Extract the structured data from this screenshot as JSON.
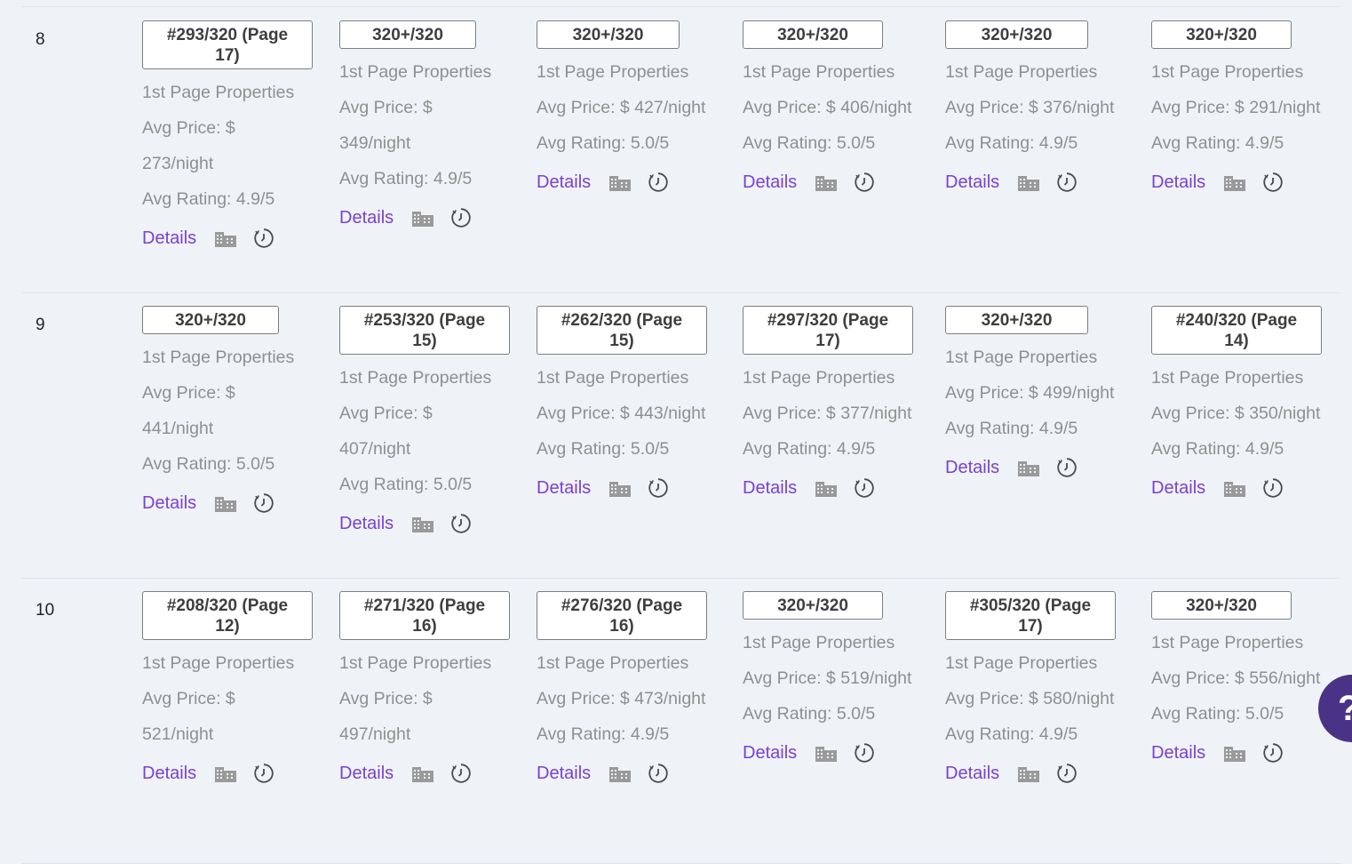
{
  "labels": {
    "properties": "1st Page Properties",
    "details": "Details",
    "avg_price_prefix": "Avg Price: $",
    "avg_rating_prefix": "Avg Rating: "
  },
  "icons": {
    "building": "building-icon",
    "history": "history-icon"
  },
  "colors": {
    "link": "#7a40cf",
    "muted_text": "#8f8f8f",
    "icon": "#9a9a9a",
    "help_button": "#4a3386"
  },
  "help_button": {
    "label": "?"
  },
  "rows": [
    {
      "num": "8",
      "cells": [
        {
          "rank_line1": "#293/320 (Page",
          "rank_line2": "17)",
          "price_line1": "Avg Price: $",
          "price_line2": "273/night",
          "rating": "Avg Rating: 4.9/5"
        },
        {
          "rank_line1": "320+/320",
          "rank_line2": "",
          "price_line1": "Avg Price: $",
          "price_line2": "349/night",
          "rating": "Avg Rating: 4.9/5"
        },
        {
          "rank_line1": "320+/320",
          "rank_line2": "",
          "price_line1": "Avg Price: $ 427/night",
          "price_line2": "",
          "rating": "Avg Rating: 5.0/5"
        },
        {
          "rank_line1": "320+/320",
          "rank_line2": "",
          "price_line1": "Avg Price: $ 406/night",
          "price_line2": "",
          "rating": "Avg Rating: 5.0/5"
        },
        {
          "rank_line1": "320+/320",
          "rank_line2": "",
          "price_line1": "Avg Price: $ 376/night",
          "price_line2": "",
          "rating": "Avg Rating: 4.9/5"
        },
        {
          "rank_line1": "320+/320",
          "rank_line2": "",
          "price_line1": "Avg Price: $ 291/night",
          "price_line2": "",
          "rating": "Avg Rating: 4.9/5"
        }
      ]
    },
    {
      "num": "9",
      "cells": [
        {
          "rank_line1": "320+/320",
          "rank_line2": "",
          "price_line1": "Avg Price: $",
          "price_line2": "441/night",
          "rating": "Avg Rating: 5.0/5"
        },
        {
          "rank_line1": "#253/320 (Page",
          "rank_line2": "15)",
          "price_line1": "Avg Price: $",
          "price_line2": "407/night",
          "rating": "Avg Rating: 5.0/5"
        },
        {
          "rank_line1": "#262/320 (Page",
          "rank_line2": "15)",
          "price_line1": "Avg Price: $ 443/night",
          "price_line2": "",
          "rating": "Avg Rating: 5.0/5"
        },
        {
          "rank_line1": "#297/320 (Page",
          "rank_line2": "17)",
          "price_line1": "Avg Price: $ 377/night",
          "price_line2": "",
          "rating": "Avg Rating: 4.9/5"
        },
        {
          "rank_line1": "320+/320",
          "rank_line2": "",
          "price_line1": "Avg Price: $ 499/night",
          "price_line2": "",
          "rating": "Avg Rating: 4.9/5"
        },
        {
          "rank_line1": "#240/320 (Page",
          "rank_line2": "14)",
          "price_line1": "Avg Price: $ 350/night",
          "price_line2": "",
          "rating": "Avg Rating: 4.9/5"
        }
      ]
    },
    {
      "num": "10",
      "cells": [
        {
          "rank_line1": "#208/320 (Page",
          "rank_line2": "12)",
          "price_line1": "Avg Price: $",
          "price_line2": "521/night",
          "rating": ""
        },
        {
          "rank_line1": "#271/320 (Page",
          "rank_line2": "16)",
          "price_line1": "Avg Price: $",
          "price_line2": "497/night",
          "rating": ""
        },
        {
          "rank_line1": "#276/320 (Page",
          "rank_line2": "16)",
          "price_line1": "Avg Price: $ 473/night",
          "price_line2": "",
          "rating": "Avg Rating: 4.9/5"
        },
        {
          "rank_line1": "320+/320",
          "rank_line2": "",
          "price_line1": "Avg Price: $ 519/night",
          "price_line2": "",
          "rating": "Avg Rating: 5.0/5"
        },
        {
          "rank_line1": "#305/320 (Page",
          "rank_line2": "17)",
          "price_line1": "Avg Price: $ 580/night",
          "price_line2": "",
          "rating": "Avg Rating: 4.9/5"
        },
        {
          "rank_line1": "320+/320",
          "rank_line2": "",
          "price_line1": "Avg Price: $ 556/night",
          "price_line2": "",
          "rating": "Avg Rating: 5.0/5"
        }
      ]
    }
  ]
}
